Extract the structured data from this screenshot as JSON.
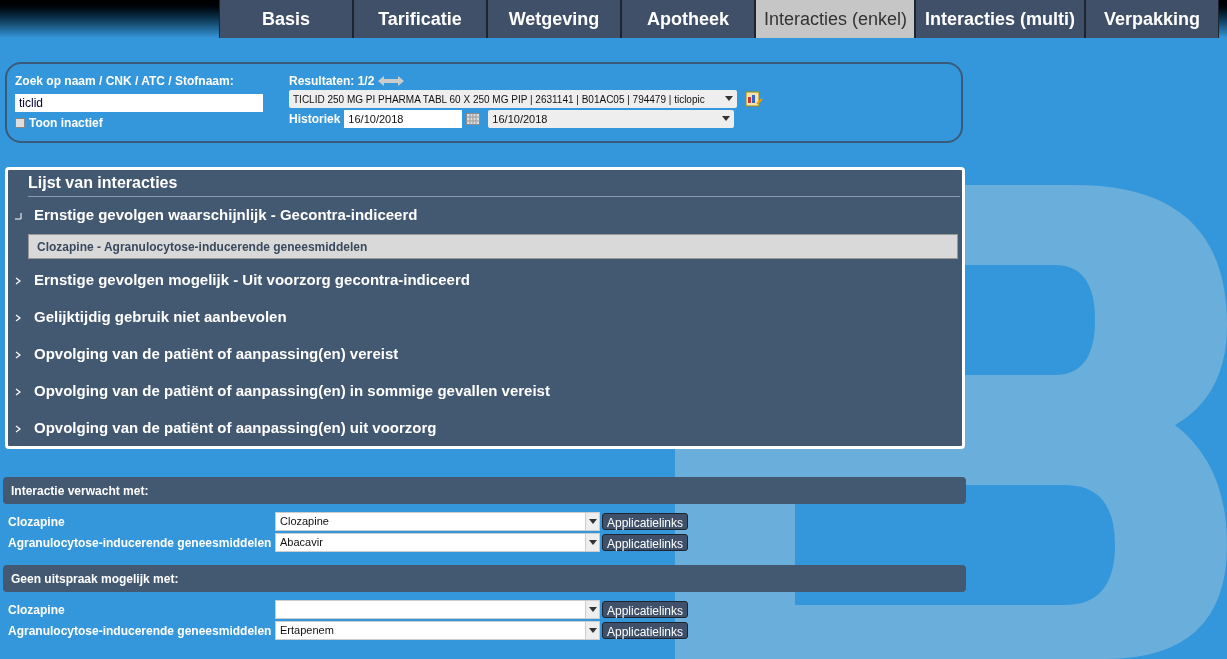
{
  "tabs": [
    {
      "label": "Basis",
      "selected": false
    },
    {
      "label": "Tarificatie",
      "selected": false
    },
    {
      "label": "Wetgeving",
      "selected": false
    },
    {
      "label": "Apotheek",
      "selected": false
    },
    {
      "label": "Interacties (enkel)",
      "selected": true
    },
    {
      "label": "Interacties (multi)",
      "selected": false
    },
    {
      "label": "Verpakking",
      "selected": false
    }
  ],
  "search": {
    "label": "Zoek op naam / CNK / ATC / Stofnaam:",
    "value": "ticlid",
    "inactive_label": "Toon inactief",
    "inactive_checked": false,
    "results_label": "Resultaten: 1/2",
    "result_value": "TICLID 250 MG PI PHARMA TABL 60 X 250 MG PIP | 2631141 | B01AC05 | 794479 | ticlopic",
    "history_label": "Historiek",
    "history_date": "16/10/2018",
    "history_select": "16/10/2018"
  },
  "interactions": {
    "title": "Lijst van interacties",
    "groups": [
      {
        "label": "Ernstige gevolgen waarschijnlijk - Gecontra-indiceerd",
        "expanded": true,
        "children": [
          {
            "label": "Clozapine - Agranulocytose-inducerende geneesmiddelen",
            "selected": true
          }
        ]
      },
      {
        "label": "Ernstige gevolgen mogelijk - Uit voorzorg gecontra-indiceerd",
        "expanded": false
      },
      {
        "label": "Gelijktijdig gebruik niet aanbevolen",
        "expanded": false
      },
      {
        "label": "Opvolging van de patiënt of aanpassing(en) vereist",
        "expanded": false
      },
      {
        "label": "Opvolging van de patiënt of aanpassing(en) in sommige gevallen vereist",
        "expanded": false
      },
      {
        "label": "Opvolging van de patiënt of aanpassing(en) uit voorzorg",
        "expanded": false
      }
    ]
  },
  "sections": [
    {
      "title": "Interactie verwacht met:",
      "rows": [
        {
          "label": "Clozapine",
          "value": "Clozapine",
          "button": "Applicatielinks"
        },
        {
          "label": "Agranulocytose-inducerende geneesmiddelen",
          "value": "Abacavir",
          "button": "Applicatielinks"
        }
      ]
    },
    {
      "title": "Geen uitspraak mogelijk met:",
      "rows": [
        {
          "label": "Clozapine",
          "value": "",
          "button": "Applicatielinks"
        },
        {
          "label": "Agranulocytose-inducerende geneesmiddelen",
          "value": "Ertapenem",
          "button": "Applicatielinks"
        }
      ]
    }
  ]
}
